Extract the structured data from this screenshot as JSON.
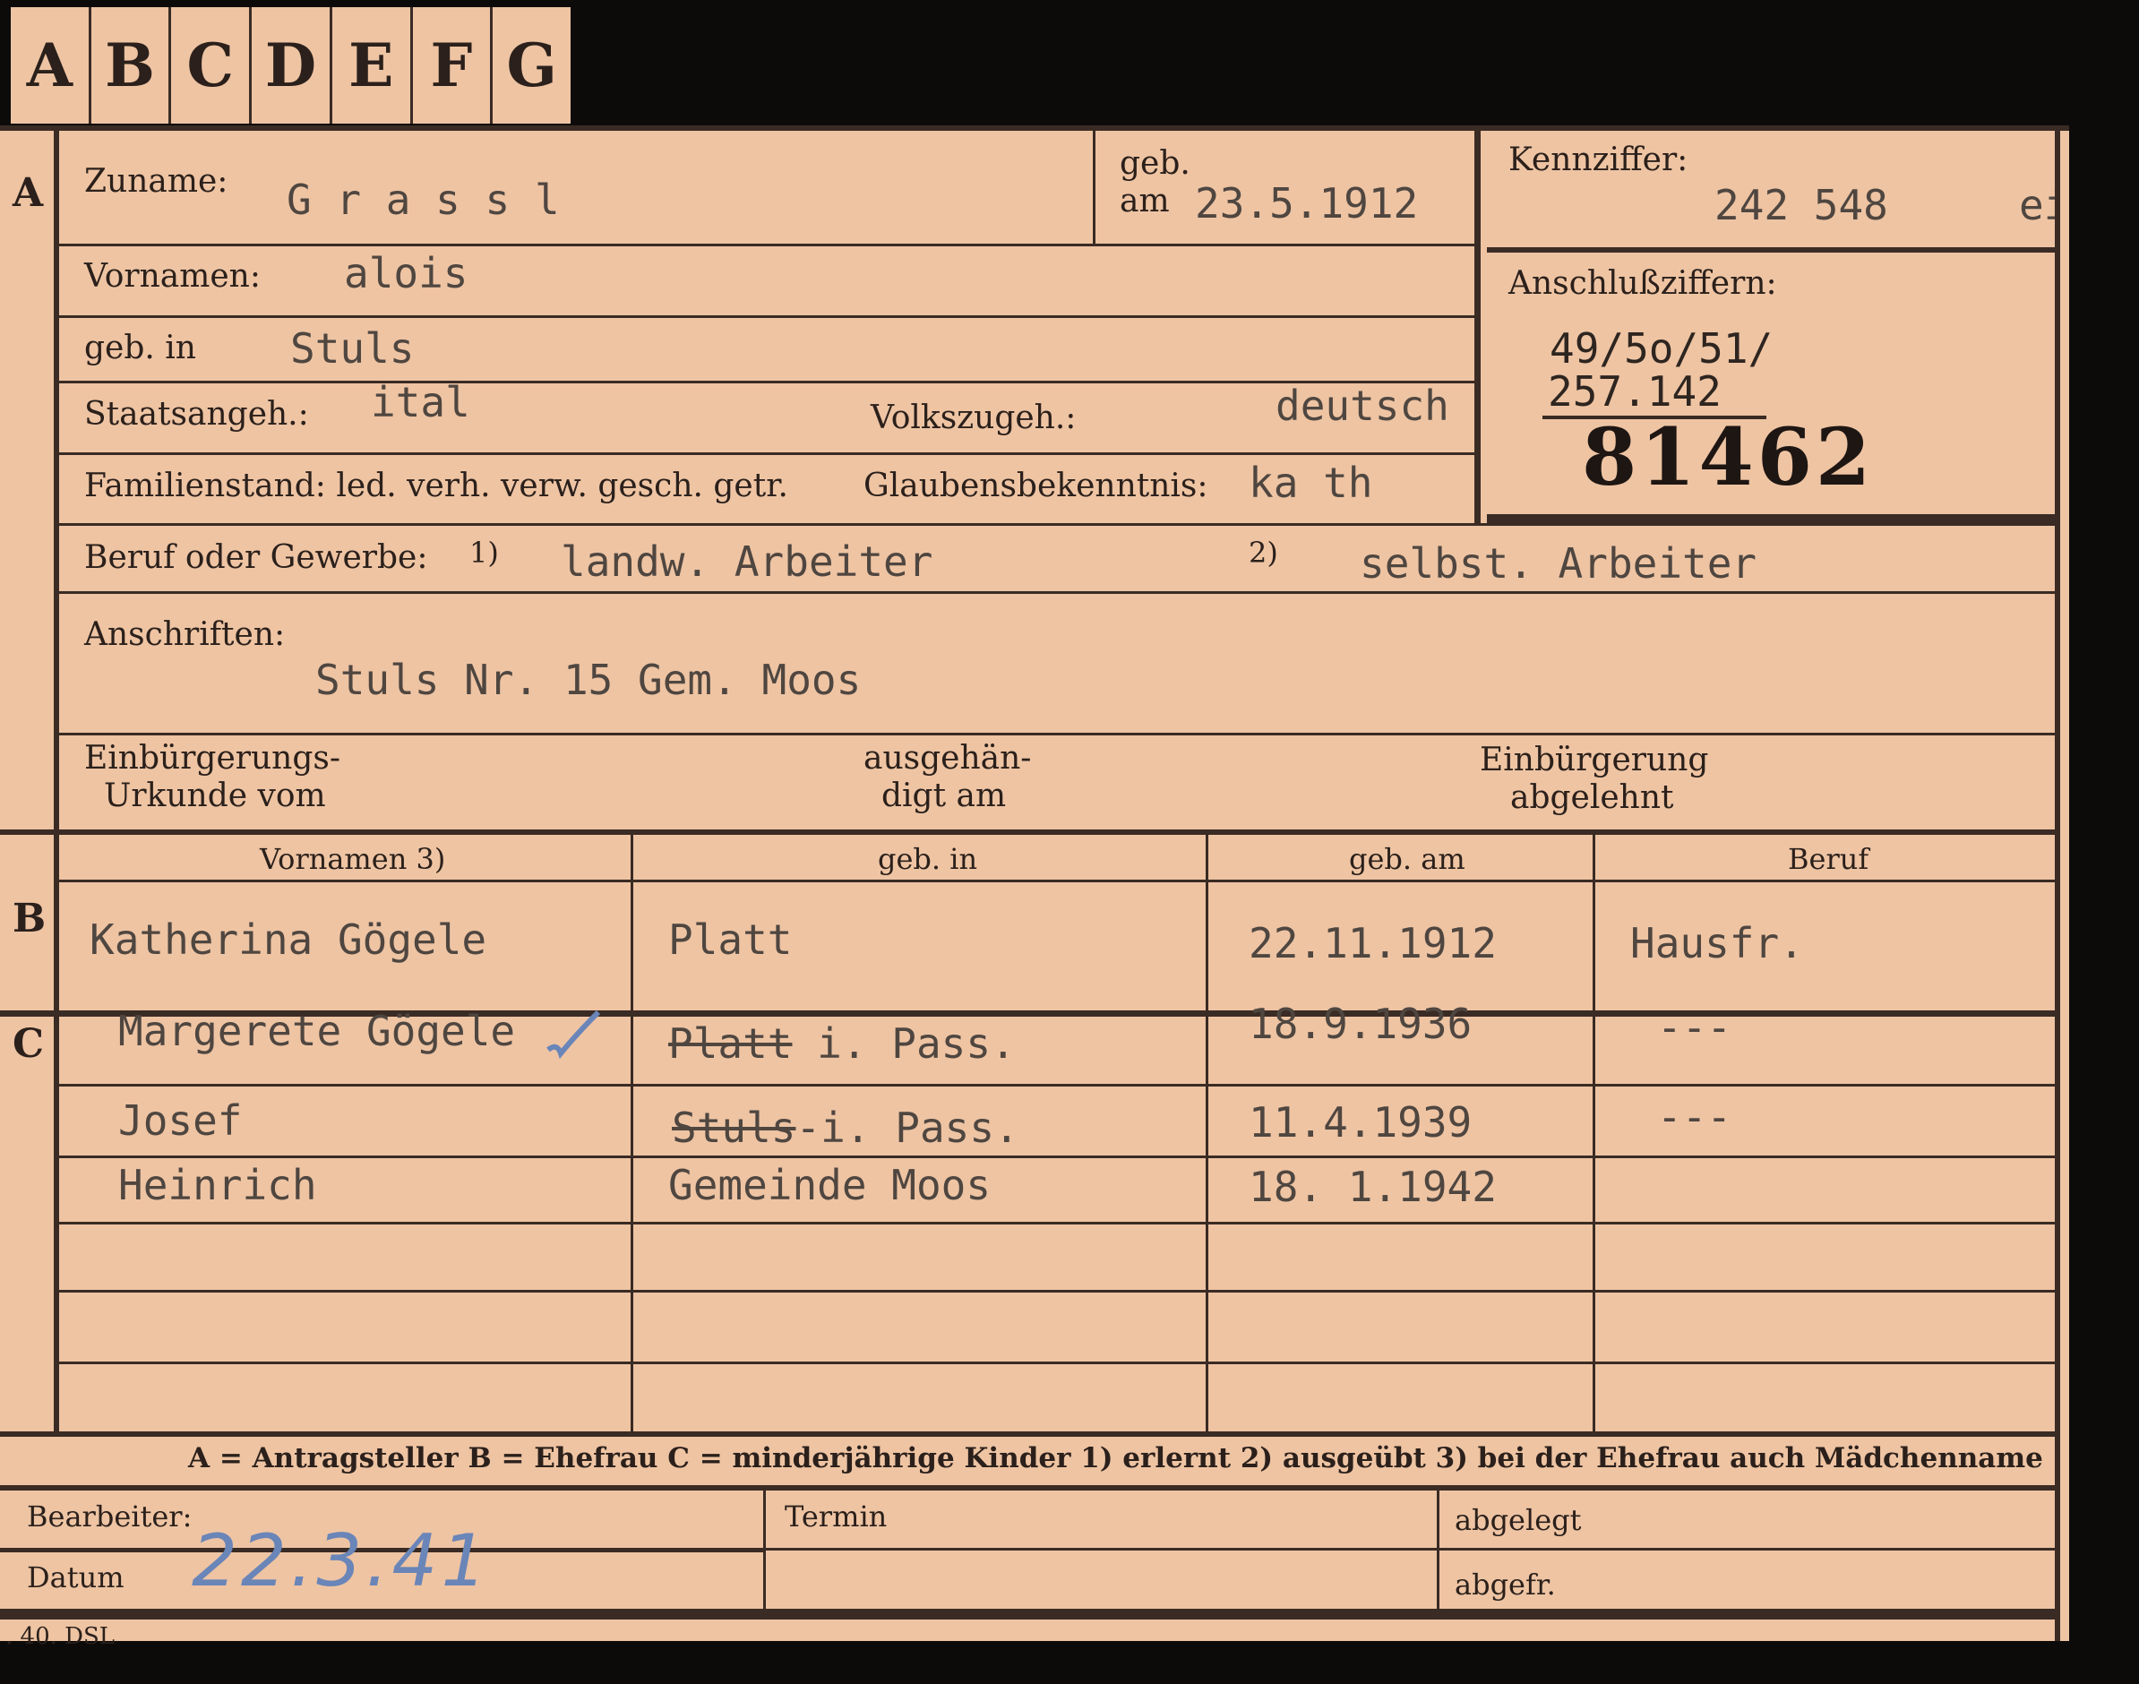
{
  "tabs": [
    "A",
    "B",
    "C",
    "D",
    "E",
    "F",
    "G"
  ],
  "sections": {
    "a": "A",
    "b": "B",
    "c": "C"
  },
  "applicant": {
    "surname_label": "Zuname:",
    "surname": "G r a s s l",
    "born_label_1": "geb.",
    "born_label_2": "am",
    "birth_date": "23.5.1912",
    "first_names_label": "Vornamen:",
    "first_names": "alois",
    "born_in_label": "geb. in",
    "born_in": "Stuls",
    "citizenship_label": "Staatsangeh.:",
    "citizenship": "ital",
    "ethnicity_label": "Volkszugeh.:",
    "ethnicity": "deutsch",
    "marital_label": "Familienstand: led. verh. verw. gesch. getr.",
    "religion_label": "Glaubensbekenntnis:",
    "religion": "ka th",
    "occupation_label": "Beruf oder Gewerbe:",
    "occ_note1": "1)",
    "occupation_learned": "landw. Arbeiter",
    "occ_note2": "2)",
    "occupation_practiced": "selbst. Arbeiter",
    "address_label": "Anschriften:",
    "address": "Stuls Nr. 15 Gem. Moos",
    "naturalization_label_1": "Einbürgerungs-",
    "naturalization_label_2": "Urkunde vom",
    "issued_label_1": "ausgehän-",
    "issued_label_2": "digt am",
    "refused_label_1": "Einbürgerung",
    "refused_label_2": "abgelehnt"
  },
  "reference": {
    "label": "Kennziffer:",
    "value": "242 548",
    "suffix": "ei",
    "connect_label": "Anschlußziffern:",
    "connect_1": "49/5o/51/",
    "connect_2": "257.142",
    "stamp_number": "81462"
  },
  "table": {
    "headers": [
      "Vornamen 3)",
      "geb. in",
      "geb. am",
      "Beruf"
    ],
    "wife": {
      "name": "Katherina Gögele",
      "place": "Platt",
      "date": "22.11.1912",
      "job": "Hausfr."
    },
    "children": [
      {
        "name": "Margerete Gögele",
        "place_struck": "Platt",
        "place": " i. Pass.",
        "date": "18.9.1936",
        "job": "---"
      },
      {
        "name": "Josef",
        "place_struck": "Stuls",
        "place": "-i. Pass.",
        "date": "11.4.1939",
        "job": "---"
      },
      {
        "name": "Heinrich",
        "place_struck": "",
        "place": "Gemeinde Moos",
        "date": "18. 1.1942",
        "job": ""
      }
    ]
  },
  "legend": "A = Antragsteller   B = Ehefrau   C = minderjährige Kinder   1) erlernt   2) ausgeübt   3) bei der Ehefrau auch Mädchenname",
  "footer": {
    "processor_label": "Bearbeiter:",
    "date_label": "Datum",
    "date_value": "22.3.41",
    "deadline_label": "Termin",
    "filed_label": "abgelegt",
    "done_label": "abgefr.",
    "print_code": ". 40. DSL"
  }
}
